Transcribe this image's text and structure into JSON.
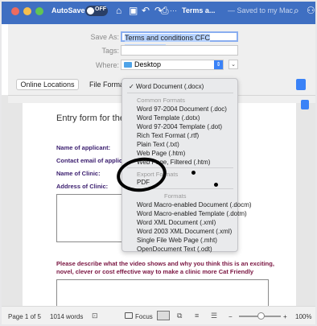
{
  "titlebar": {
    "autosave_label": "AutoSave",
    "autosave_state": "OFF",
    "doc_title": "Terms a...",
    "doc_status": "— Saved to my Mac",
    "icons": [
      "home-icon",
      "save-icon",
      "undo-icon",
      "redo-icon",
      "print-icon",
      "more-icon",
      "search-icon",
      "share-icon"
    ],
    "home_glyph": "⌂",
    "save_glyph": "▣",
    "undo_glyph": "↶",
    "redo_glyph": "↷",
    "print_glyph": "⎙",
    "more_glyph": "···",
    "search_glyph": "⌕",
    "share_glyph": "⚇"
  },
  "save_dialog": {
    "save_as_label": "Save As:",
    "save_as_value": "Terms and conditions CFC awards.docx",
    "tags_label": "Tags:",
    "where_label": "Where:",
    "where_value": "Desktop",
    "online_locations_label": "Online Locations",
    "file_format_label": "File Format"
  },
  "format_menu": {
    "selected": "Word Document (.docx)",
    "check_glyph": "✓",
    "common_header": "Common Formats",
    "common": [
      "Word 97-2004 Document (.doc)",
      "Word Template (.dotx)",
      "Word 97-2004 Template (.dot)",
      "Rich Text Format (.rtf)",
      "Plain Text (.txt)",
      "Web Page (.htm)",
      "Web Page, Filtered (.htm)"
    ],
    "export_header": "Export Formats",
    "export": [
      "PDF"
    ],
    "specialty_header": "Formats",
    "specialty": [
      "Word Macro-enabled Document (.docm)",
      "Word Macro-enabled Template (.dotm)",
      "Word XML Document (.xml)",
      "Word 2003 XML Document (.xml)",
      "Single File Web Page (.mht)",
      "OpenDocument Text (.odt)"
    ]
  },
  "document": {
    "heading": "Entry form for the",
    "fields": [
      "Name of applicant:",
      "Contact email of applica",
      "Name of Clinic:",
      "Address of Clinic:"
    ],
    "paragraph": "Please describe what the video shows and why you think this is an exciting, novel, clever or cost effective way to make a clinic more Cat Friendly"
  },
  "statusbar": {
    "page": "Page 1 of 5",
    "words": "1014 words",
    "focus": "Focus",
    "zoom": "100%",
    "zoom_minus": "−",
    "zoom_plus": "+",
    "zoom_level": 0.6
  },
  "colors": {
    "titlebar": "#3f6fc2",
    "accent": "#3a82f7",
    "form_label": "#3a1d6e",
    "paragraph": "#7a1541"
  }
}
